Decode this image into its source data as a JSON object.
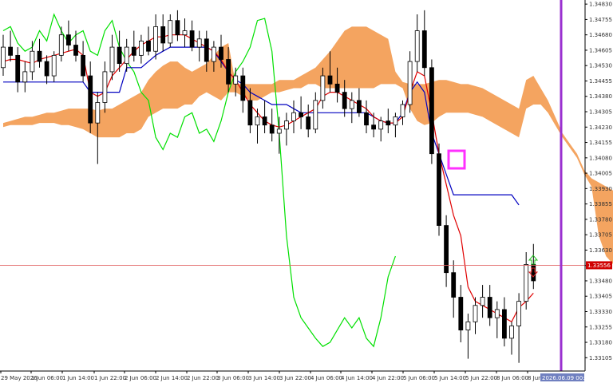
{
  "chart_data": {
    "type": "candlestick",
    "symbol_view": "ichimoku",
    "colors": {
      "background": "#ffffff",
      "candle": "#000000",
      "tenkan": "#e00000",
      "kijun": "#0000c0",
      "chikou": "#00e000",
      "kumo_bull": "#f4a460",
      "kumo_bear": "#d8bfd8",
      "hline": "#e06060",
      "vline": "#9a30d0",
      "box": "#ff30ff",
      "arrow_up": "#20c020",
      "arrow_down": "#e02020",
      "price_tag_bg": "#d00000",
      "time_tag_bg": "#7080c0"
    },
    "y_axis": {
      "min": 1.3304,
      "max": 1.3485,
      "ticks": [
        "1.34830",
        "1.34755",
        "1.34680",
        "1.34605",
        "1.34530",
        "1.34455",
        "1.34380",
        "1.34305",
        "1.34230",
        "1.34155",
        "1.34080",
        "1.34005",
        "1.33930",
        "1.33855",
        "1.33780",
        "1.33705",
        "1.33630",
        "1.33555",
        "1.33480",
        "1.33405",
        "1.33330",
        "1.33255",
        "1.33180",
        "1.33105"
      ],
      "current_price": "1.33556"
    },
    "x_axis": {
      "ticks": [
        "29 May 2026",
        "1 Jun 06:00",
        "1 Jun 14:00",
        "1 Jun 22:00",
        "2 Jun 06:00",
        "2 Jun 14:00",
        "2 Jun 22:00",
        "3 Jun 06:00",
        "3 Jun 14:00",
        "3 Jun 22:00",
        "4 Jun 06:00",
        "4 Jun 14:00",
        "4 Jun 22:00",
        "5 Jun 06:00",
        "5 Jun 14:00",
        "5 Jun 22:00",
        "8 Jun 06:00",
        "8 Jun 14:00"
      ],
      "time_tag": "2026.06.09 00:00"
    },
    "candles": [
      [
        1.3452,
        1.3468,
        1.3448,
        1.3462
      ],
      [
        1.3462,
        1.347,
        1.3455,
        1.3458
      ],
      [
        1.3458,
        1.3462,
        1.344,
        1.3445
      ],
      [
        1.3445,
        1.3455,
        1.344,
        1.345
      ],
      [
        1.345,
        1.3465,
        1.3446,
        1.346
      ],
      [
        1.346,
        1.3466,
        1.3452,
        1.3455
      ],
      [
        1.3455,
        1.3458,
        1.3444,
        1.3448
      ],
      [
        1.3448,
        1.346,
        1.3445,
        1.3458
      ],
      [
        1.3458,
        1.3472,
        1.3455,
        1.3468
      ],
      [
        1.3468,
        1.3475,
        1.346,
        1.3463
      ],
      [
        1.3463,
        1.347,
        1.3455,
        1.3458
      ],
      [
        1.3458,
        1.3465,
        1.3445,
        1.3448
      ],
      [
        1.3448,
        1.3455,
        1.342,
        1.3425
      ],
      [
        1.3425,
        1.344,
        1.3405,
        1.3435
      ],
      [
        1.3435,
        1.3455,
        1.343,
        1.345
      ],
      [
        1.345,
        1.3468,
        1.3446,
        1.3462
      ],
      [
        1.3462,
        1.347,
        1.345,
        1.3454
      ],
      [
        1.3454,
        1.3466,
        1.345,
        1.3462
      ],
      [
        1.3462,
        1.347,
        1.3455,
        1.3458
      ],
      [
        1.3458,
        1.3468,
        1.3454,
        1.3465
      ],
      [
        1.3465,
        1.3472,
        1.3458,
        1.346
      ],
      [
        1.346,
        1.3478,
        1.3456,
        1.3472
      ],
      [
        1.3472,
        1.3478,
        1.346,
        1.3464
      ],
      [
        1.3464,
        1.3478,
        1.3462,
        1.3475
      ],
      [
        1.3475,
        1.348,
        1.3465,
        1.3468
      ],
      [
        1.3468,
        1.3476,
        1.3462,
        1.347
      ],
      [
        1.347,
        1.3475,
        1.346,
        1.3462
      ],
      [
        1.3462,
        1.347,
        1.3455,
        1.3466
      ],
      [
        1.3466,
        1.347,
        1.345,
        1.3455
      ],
      [
        1.3455,
        1.3465,
        1.345,
        1.3462
      ],
      [
        1.3462,
        1.3468,
        1.3452,
        1.3456
      ],
      [
        1.3456,
        1.3462,
        1.344,
        1.3444
      ],
      [
        1.3444,
        1.3452,
        1.3438,
        1.3448
      ],
      [
        1.3448,
        1.3452,
        1.343,
        1.3436
      ],
      [
        1.3436,
        1.3442,
        1.342,
        1.3424
      ],
      [
        1.3424,
        1.3432,
        1.3415,
        1.3428
      ],
      [
        1.3428,
        1.3436,
        1.342,
        1.3424
      ],
      [
        1.3424,
        1.3432,
        1.3416,
        1.342
      ],
      [
        1.342,
        1.3428,
        1.341,
        1.3422
      ],
      [
        1.3422,
        1.343,
        1.3414,
        1.3426
      ],
      [
        1.3426,
        1.3436,
        1.342,
        1.343
      ],
      [
        1.343,
        1.3438,
        1.3422,
        1.3428
      ],
      [
        1.3428,
        1.3434,
        1.3418,
        1.3422
      ],
      [
        1.3422,
        1.344,
        1.342,
        1.3436
      ],
      [
        1.3436,
        1.3452,
        1.3432,
        1.3448
      ],
      [
        1.3448,
        1.346,
        1.344,
        1.3444
      ],
      [
        1.3444,
        1.3452,
        1.3435,
        1.344
      ],
      [
        1.344,
        1.3446,
        1.3428,
        1.3432
      ],
      [
        1.3432,
        1.344,
        1.3425,
        1.3436
      ],
      [
        1.3436,
        1.3442,
        1.3428,
        1.343
      ],
      [
        1.343,
        1.3436,
        1.342,
        1.3424
      ],
      [
        1.3424,
        1.343,
        1.3418,
        1.3422
      ],
      [
        1.3422,
        1.3428,
        1.3416,
        1.3426
      ],
      [
        1.3426,
        1.3432,
        1.342,
        1.3424
      ],
      [
        1.3424,
        1.343,
        1.3418,
        1.3428
      ],
      [
        1.3428,
        1.3436,
        1.3424,
        1.3434
      ],
      [
        1.3434,
        1.346,
        1.343,
        1.3455
      ],
      [
        1.3455,
        1.3478,
        1.345,
        1.347
      ],
      [
        1.347,
        1.348,
        1.3448,
        1.3452
      ],
      [
        1.3452,
        1.3456,
        1.3405,
        1.341
      ],
      [
        1.341,
        1.3415,
        1.337,
        1.3375
      ],
      [
        1.3375,
        1.338,
        1.3345,
        1.3352
      ],
      [
        1.3352,
        1.3358,
        1.333,
        1.334
      ],
      [
        1.334,
        1.3346,
        1.3318,
        1.3324
      ],
      [
        1.3324,
        1.3332,
        1.331,
        1.3328
      ],
      [
        1.3328,
        1.334,
        1.3322,
        1.3336
      ],
      [
        1.3336,
        1.3346,
        1.333,
        1.334
      ],
      [
        1.334,
        1.3346,
        1.3326,
        1.333
      ],
      [
        1.333,
        1.3338,
        1.332,
        1.3334
      ],
      [
        1.3334,
        1.334,
        1.3316,
        1.332
      ],
      [
        1.332,
        1.3328,
        1.3312,
        1.3326
      ],
      [
        1.3326,
        1.3342,
        1.3308,
        1.3338
      ],
      [
        1.3338,
        1.3362,
        1.3334,
        1.3356
      ],
      [
        1.3356,
        1.3366,
        1.3344,
        1.3348
      ]
    ],
    "tenkan": [
      1.3455,
      1.3456,
      1.3456,
      1.3455,
      1.3454,
      1.3456,
      1.3457,
      1.3458,
      1.3459,
      1.346,
      1.3461,
      1.3458,
      1.344,
      1.3438,
      1.344,
      1.3448,
      1.3452,
      1.3456,
      1.346,
      1.3463,
      1.3465,
      1.3467,
      1.3467,
      1.3468,
      1.3468,
      1.3468,
      1.3466,
      1.3464,
      1.3462,
      1.346,
      1.3456,
      1.345,
      1.3446,
      1.344,
      1.3434,
      1.343,
      1.3426,
      1.3424,
      1.3423,
      1.3424,
      1.3426,
      1.3428,
      1.343,
      1.3432,
      1.3438,
      1.344,
      1.344,
      1.3438,
      1.3436,
      1.3434,
      1.3432,
      1.3428,
      1.3426,
      1.3425,
      1.3425,
      1.3428,
      1.344,
      1.345,
      1.3448,
      1.343,
      1.341,
      1.3395,
      1.338,
      1.337,
      1.3345,
      1.3338,
      1.3336,
      1.3334,
      1.3332,
      1.333,
      1.3328,
      1.3335,
      1.3338,
      1.3342
    ],
    "kijun": [
      1.3445,
      1.3445,
      1.3445,
      1.3445,
      1.3445,
      1.3445,
      1.3445,
      1.3445,
      1.3445,
      1.3445,
      1.3445,
      1.3445,
      1.344,
      1.344,
      1.344,
      1.344,
      1.344,
      1.3452,
      1.3452,
      1.3452,
      1.3455,
      1.3458,
      1.346,
      1.3462,
      1.3462,
      1.3462,
      1.3462,
      1.3462,
      1.3462,
      1.346,
      1.3455,
      1.345,
      1.3446,
      1.3444,
      1.344,
      1.3438,
      1.3436,
      1.3434,
      1.3434,
      1.3434,
      1.3432,
      1.343,
      1.343,
      1.343,
      1.343,
      1.343,
      1.343,
      1.343,
      1.343,
      1.343,
      1.343,
      1.3428,
      1.3426,
      1.3425,
      1.3425,
      1.343,
      1.344,
      1.3445,
      1.344,
      1.342,
      1.341,
      1.34,
      1.339,
      1.339,
      1.339,
      1.339,
      1.339,
      1.339,
      1.339,
      1.339,
      1.339,
      1.3385
    ],
    "chikou": [
      1.347,
      1.3472,
      1.3464,
      1.346,
      1.3462,
      1.347,
      1.3465,
      1.3478,
      1.347,
      1.3464,
      1.3468,
      1.347,
      1.346,
      1.3458,
      1.347,
      1.3475,
      1.3462,
      1.3455,
      1.345,
      1.344,
      1.3436,
      1.3418,
      1.3412,
      1.342,
      1.3418,
      1.3428,
      1.343,
      1.342,
      1.3422,
      1.3416,
      1.3426,
      1.344,
      1.345,
      1.3455,
      1.3462,
      1.3475,
      1.3476,
      1.346,
      1.342,
      1.337,
      1.334,
      1.333,
      1.3325,
      1.332,
      1.3316,
      1.3318,
      1.3324,
      1.333,
      1.3325,
      1.333,
      1.332,
      1.3316,
      1.333,
      1.335,
      1.336
    ],
    "kumo": [
      [
        1.3425,
        1.3423
      ],
      [
        1.3426,
        1.3424
      ],
      [
        1.3427,
        1.3424
      ],
      [
        1.3428,
        1.3424
      ],
      [
        1.3428,
        1.3424
      ],
      [
        1.3429,
        1.3425
      ],
      [
        1.343,
        1.3425
      ],
      [
        1.343,
        1.3425
      ],
      [
        1.3431,
        1.3424
      ],
      [
        1.3432,
        1.3424
      ],
      [
        1.3432,
        1.3423
      ],
      [
        1.3432,
        1.3422
      ],
      [
        1.3432,
        1.342
      ],
      [
        1.3431,
        1.3418
      ],
      [
        1.3432,
        1.3418
      ],
      [
        1.3432,
        1.3418
      ],
      [
        1.3434,
        1.3418
      ],
      [
        1.3436,
        1.342
      ],
      [
        1.3438,
        1.342
      ],
      [
        1.344,
        1.3422
      ],
      [
        1.3446,
        1.3428
      ],
      [
        1.345,
        1.343
      ],
      [
        1.3453,
        1.3432
      ],
      [
        1.3455,
        1.3432
      ],
      [
        1.3455,
        1.3432
      ],
      [
        1.3452,
        1.3434
      ],
      [
        1.345,
        1.3434
      ],
      [
        1.3452,
        1.3438
      ],
      [
        1.3454,
        1.344
      ],
      [
        1.3458,
        1.3438
      ],
      [
        1.3462,
        1.3436
      ],
      [
        1.3464,
        1.344
      ],
      [
        1.3444,
        1.344
      ],
      [
        1.3444,
        1.3438
      ],
      [
        1.3444,
        1.3436
      ],
      [
        1.3444,
        1.3436
      ],
      [
        1.3444,
        1.3438
      ],
      [
        1.3444,
        1.344
      ],
      [
        1.3446,
        1.344
      ],
      [
        1.3446,
        1.3441
      ],
      [
        1.3446,
        1.3442
      ],
      [
        1.3448,
        1.3442
      ],
      [
        1.345,
        1.3444
      ],
      [
        1.3452,
        1.3444
      ],
      [
        1.3456,
        1.3442
      ],
      [
        1.346,
        1.3442
      ],
      [
        1.3465,
        1.3442
      ],
      [
        1.347,
        1.3442
      ],
      [
        1.3472,
        1.3442
      ],
      [
        1.3472,
        1.3442
      ],
      [
        1.3472,
        1.3442
      ],
      [
        1.347,
        1.3442
      ],
      [
        1.3468,
        1.3444
      ],
      [
        1.3466,
        1.3444
      ],
      [
        1.345,
        1.3444
      ],
      [
        1.3445,
        1.3442
      ],
      [
        1.3444,
        1.3432
      ],
      [
        1.3444,
        1.3426
      ],
      [
        1.3444,
        1.3424
      ],
      [
        1.3445,
        1.3425
      ],
      [
        1.3446,
        1.3428
      ],
      [
        1.3446,
        1.343
      ],
      [
        1.3445,
        1.343
      ],
      [
        1.3444,
        1.343
      ],
      [
        1.3444,
        1.343
      ],
      [
        1.3443,
        1.3429
      ],
      [
        1.3442,
        1.3428
      ],
      [
        1.344,
        1.3426
      ],
      [
        1.3438,
        1.3424
      ],
      [
        1.3436,
        1.3422
      ],
      [
        1.3434,
        1.342
      ],
      [
        1.3432,
        1.3418
      ],
      [
        1.3446,
        1.3432
      ],
      [
        1.3448,
        1.3434
      ],
      [
        1.3442,
        1.3434
      ],
      [
        1.3436,
        1.343
      ],
      [
        1.3428,
        1.3424
      ],
      [
        1.342,
        1.3418
      ],
      [
        1.3415,
        1.3413
      ],
      [
        1.341,
        1.3408
      ],
      [
        1.3402,
        1.34
      ],
      [
        1.3398,
        1.3394
      ],
      [
        1.3396,
        1.337
      ],
      [
        1.3394,
        1.336
      ],
      [
        1.3392,
        1.3356
      ],
      [
        1.339,
        1.3352
      ]
    ],
    "vline_label": "2026.06.09 00:00"
  }
}
